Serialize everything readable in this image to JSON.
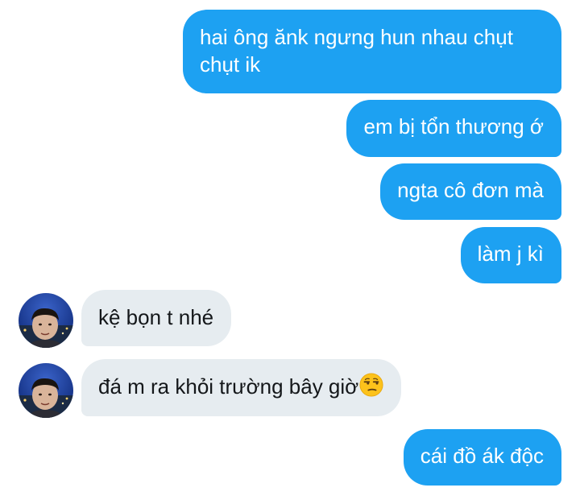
{
  "conversation": {
    "messages": [
      {
        "sender": "me",
        "text": "hai ông ănk ngưng hun nhau chụt chụt ik"
      },
      {
        "sender": "me",
        "text": "em bị tổn thương ớ"
      },
      {
        "sender": "me",
        "text": "ngta cô đơn mà"
      },
      {
        "sender": "me",
        "text": "làm j kì"
      },
      {
        "sender": "other",
        "text": "kệ bọn t nhé"
      },
      {
        "sender": "other",
        "text": "đá m ra khỏi trường bây giờ",
        "emoji": "unamused-face-icon"
      },
      {
        "sender": "me",
        "text": "cái đồ ák độc"
      }
    ]
  },
  "colors": {
    "outgoing_bubble": "#1da1f2",
    "incoming_bubble": "#e6ecf0",
    "outgoing_text": "#ffffff",
    "incoming_text": "#14171a",
    "background": "#ffffff"
  }
}
